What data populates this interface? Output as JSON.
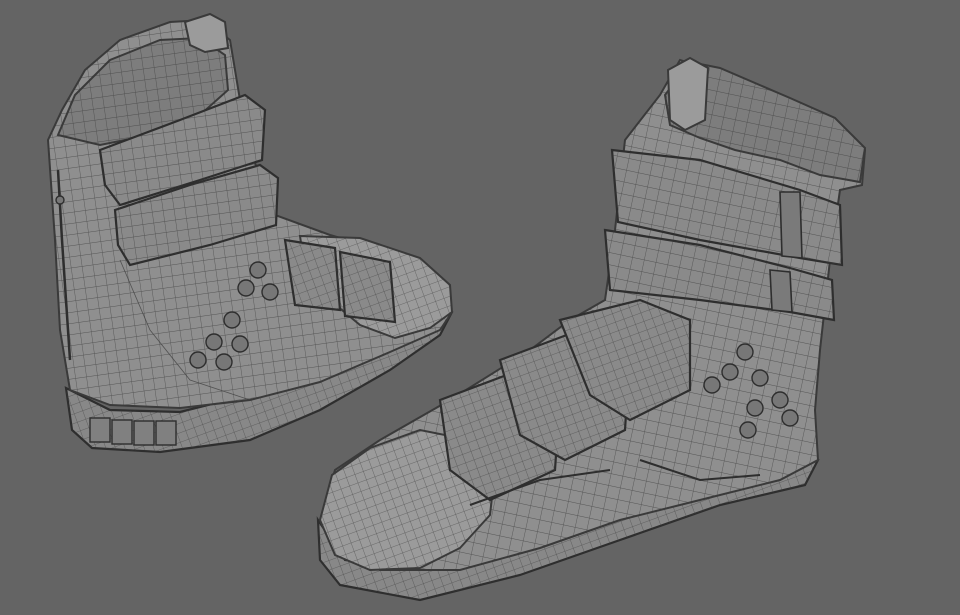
{
  "scene": {
    "background_color": "#646464",
    "mesh_color": "#8f8f8f",
    "wire_color": "#3c3c3c",
    "objects": [
      {
        "name": "left-boot",
        "view": "rear-three-quarter"
      },
      {
        "name": "right-boot",
        "view": "front-three-quarter"
      }
    ]
  }
}
